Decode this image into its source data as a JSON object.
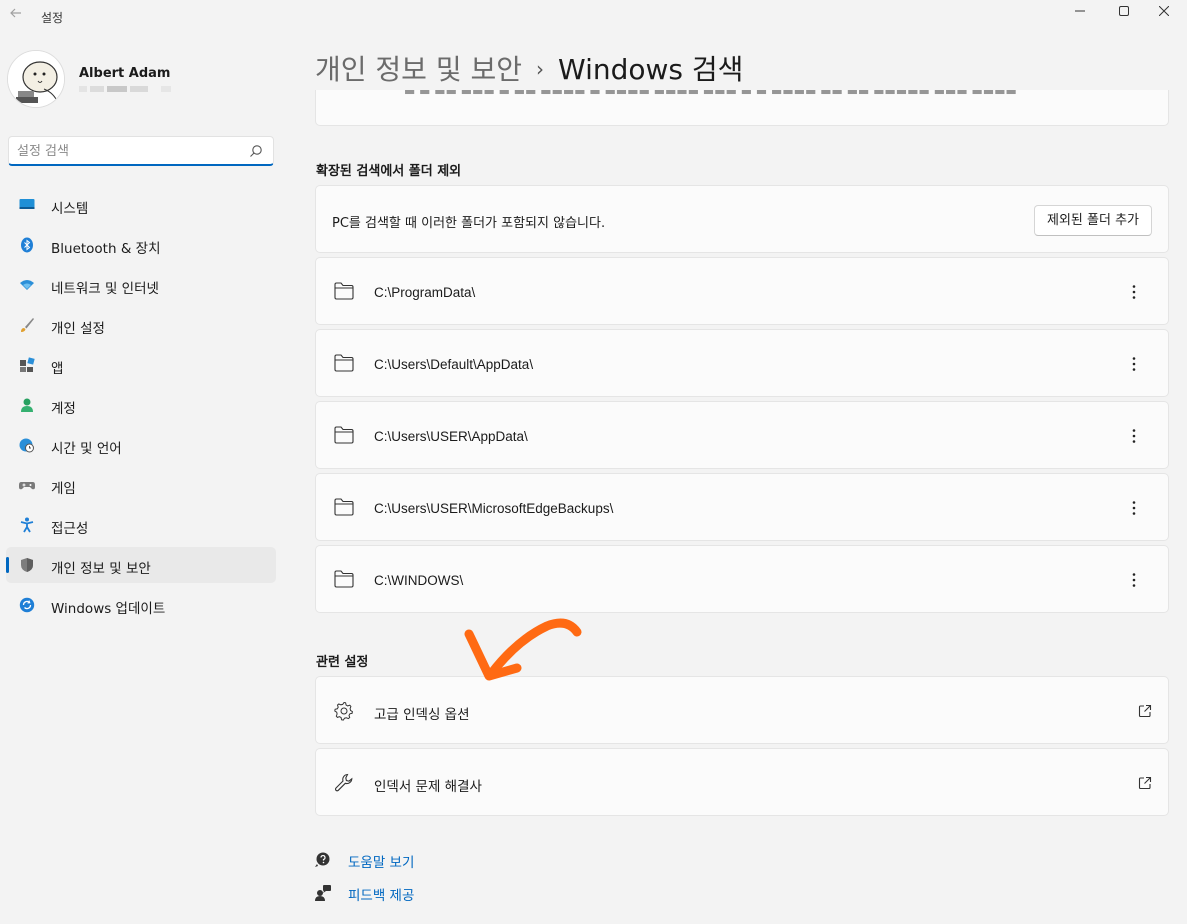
{
  "window": {
    "title": "설정",
    "back_icon": "arrow-left-icon",
    "controls": [
      "minimize-icon",
      "maximize-icon",
      "close-icon"
    ]
  },
  "profile": {
    "name": "Albert Adam"
  },
  "search": {
    "placeholder": "설정 검색",
    "icon": "search-icon"
  },
  "sidebar": {
    "items": [
      {
        "label": "시스템",
        "icon": "system-icon",
        "active": false
      },
      {
        "label": "Bluetooth & 장치",
        "icon": "bluetooth-icon",
        "active": false
      },
      {
        "label": "네트워크 및 인터넷",
        "icon": "wifi-icon",
        "active": false
      },
      {
        "label": "개인 설정",
        "icon": "brush-icon",
        "active": false
      },
      {
        "label": "앱",
        "icon": "apps-icon",
        "active": false
      },
      {
        "label": "계정",
        "icon": "account-icon",
        "active": false
      },
      {
        "label": "시간 및 언어",
        "icon": "clock-globe-icon",
        "active": false
      },
      {
        "label": "게임",
        "icon": "gamepad-icon",
        "active": false
      },
      {
        "label": "접근성",
        "icon": "accessibility-icon",
        "active": false
      },
      {
        "label": "개인 정보 및 보안",
        "icon": "shield-icon",
        "active": true
      },
      {
        "label": "Windows 업데이트",
        "icon": "update-icon",
        "active": false
      }
    ]
  },
  "header": {
    "parent": "개인 정보 및 보안",
    "separator": "›",
    "current": "Windows 검색"
  },
  "exclude_section": {
    "title": "확장된 검색에서 폴더 제외",
    "description": "PC를 검색할 때 이러한 폴더가 포함되지 않습니다.",
    "add_button": "제외된 폴더 추가",
    "folders": [
      "C:\\ProgramData\\",
      "C:\\Users\\Default\\AppData\\",
      "C:\\Users\\USER\\AppData\\",
      "C:\\Users\\USER\\MicrosoftEdgeBackups\\",
      "C:\\WINDOWS\\"
    ]
  },
  "related_section": {
    "title": "관련 설정",
    "items": [
      {
        "label": "고급 인덱싱 옵션",
        "icon": "gear-icon"
      },
      {
        "label": "인덱서 문제 해결사",
        "icon": "wrench-icon"
      }
    ]
  },
  "footer": {
    "help": "도움말 보기",
    "feedback": "피드백 제공"
  },
  "colors": {
    "accent": "#0067c0",
    "annotation": "#ff6a13",
    "background": "#f3f3f3",
    "card": "#fbfbfb"
  }
}
